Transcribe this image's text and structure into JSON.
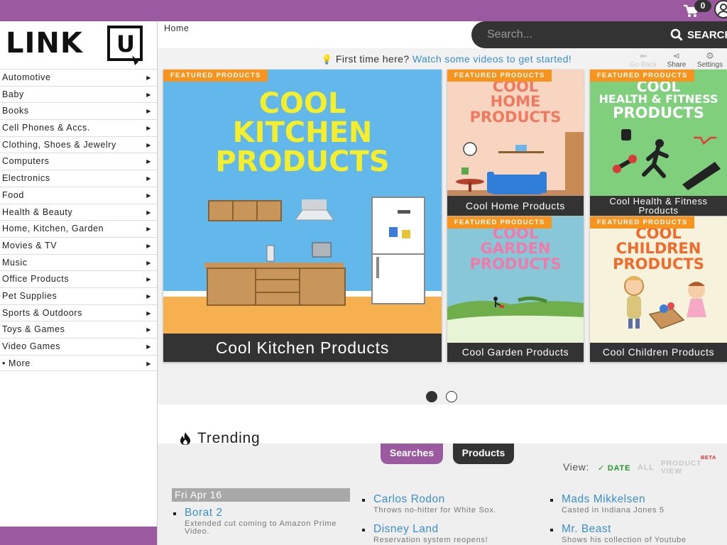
{
  "header": {
    "cart_count": "0",
    "logo_text": "LINKU"
  },
  "search": {
    "placeholder": "Search...",
    "button_label": "SEARCH"
  },
  "breadcrumb": "Home",
  "welcome": {
    "prefix": "First time here?",
    "link": "Watch some videos to get started!"
  },
  "toolbar": {
    "go_back": "Go Back",
    "share": "Share",
    "settings": "Settings"
  },
  "categories": [
    "Automotive",
    "Baby",
    "Books",
    "Cell Phones & Accs.",
    "Clothing, Shoes & Jewelry",
    "Computers",
    "Electronics",
    "Food",
    "Health & Beauty",
    "Home, Kitchen, Garden",
    "Movies & TV",
    "Music",
    "Office Products",
    "Pet Supplies",
    "Sports & Outdoors",
    "Toys & Games",
    "Video Games",
    "• More"
  ],
  "featured": {
    "tag": "FEATURED PRODUCTS",
    "tiles": [
      {
        "headline": [
          "COOL",
          "KITCHEN",
          "PRODUCTS"
        ],
        "caption": "Cool Kitchen Products"
      },
      {
        "headline": [
          "COOL",
          "HOME",
          "PRODUCTS"
        ],
        "caption": "Cool Home Products"
      },
      {
        "headline": [
          "COOL",
          "HEALTH & FITNESS",
          "PRODUCTS"
        ],
        "caption": "Cool Health & Fitness Products"
      },
      {
        "headline": [
          "COOL",
          "GARDEN",
          "PRODUCTS"
        ],
        "caption": "Cool Garden Products"
      },
      {
        "headline": [
          "COOL",
          "CHILDREN",
          "PRODUCTS"
        ],
        "caption": "Cool Children Products"
      }
    ]
  },
  "carousel": {
    "pages": 2,
    "active": 1
  },
  "trending": {
    "title": "Trending",
    "tabs": [
      "Searches",
      "Products"
    ],
    "view_label": "View:",
    "view_options": [
      "✓ DATE",
      "ALL",
      "PRODUCT VIEW"
    ],
    "beta": "BETA",
    "date_heading": "Fri Apr 16",
    "items": [
      {
        "title": "Borat 2",
        "desc": "Extended cut coming to Amazon Prime Video."
      },
      {
        "title": "Carlos Rodon",
        "desc": "Throws no-hitter for White Sox."
      },
      {
        "title": "Mads Mikkelsen",
        "desc": "Casted in Indiana Jones 5"
      },
      {
        "title": "Disney Land",
        "desc": "Reservation system reopens!"
      },
      {
        "title": "Mr. Beast",
        "desc": "Shows his collection of Youtube"
      }
    ]
  },
  "colors": {
    "brand_purple": "#9b59a0",
    "featured_tag": "#f7941d",
    "link_blue": "#3b8fc9",
    "dark": "#333333"
  }
}
